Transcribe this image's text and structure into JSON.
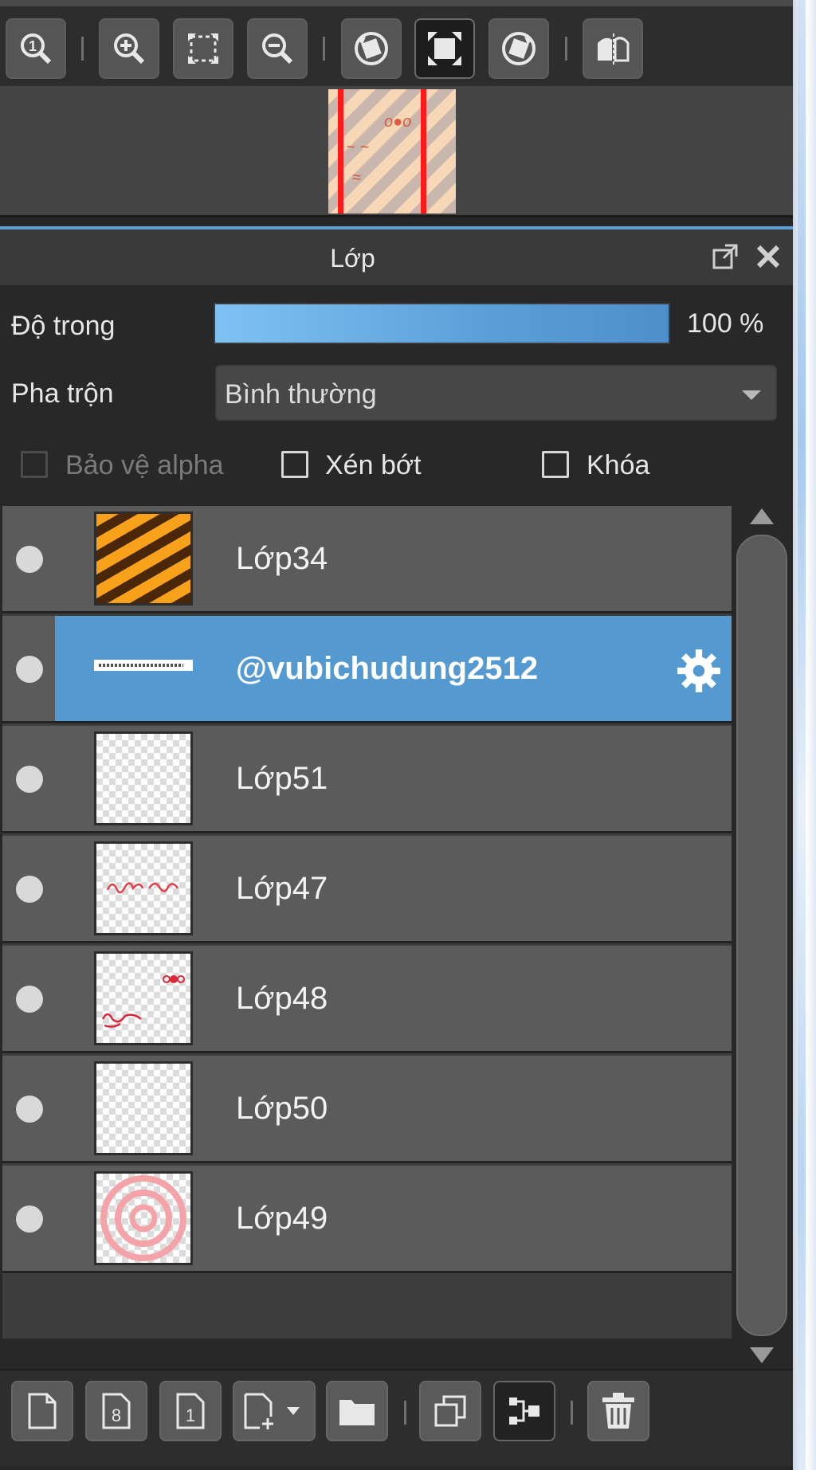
{
  "panel": {
    "title": "Lớp"
  },
  "opacity": {
    "label": "Độ trong",
    "value_text": "100 %",
    "value": 100
  },
  "blend": {
    "label": "Pha trộn",
    "selected": "Bình thường"
  },
  "options": {
    "protect_alpha": "Bảo vệ alpha",
    "clipping": "Xén bớt",
    "lock": "Khóa"
  },
  "layers": [
    {
      "name": "Lớp34",
      "thumbnail": "orange-stripes"
    },
    {
      "name": "@vubichudung2512",
      "thumbnail": "text-strip",
      "selected": true
    },
    {
      "name": "Lớp51",
      "thumbnail": "transparent"
    },
    {
      "name": "Lớp47",
      "thumbnail": "red-script"
    },
    {
      "name": "Lớp48",
      "thumbnail": "red-ornaments"
    },
    {
      "name": "Lớp50",
      "thumbnail": "transparent"
    },
    {
      "name": "Lớp49",
      "thumbnail": "pink-rings"
    }
  ],
  "colors": {
    "accent": "#5599d1",
    "panel_bg": "#282828",
    "row_bg": "#5b5b5b"
  },
  "icons": {
    "navigator_toolbar": [
      "zoom-actual-icon",
      "zoom-in-icon",
      "fit-screen-icon",
      "zoom-out-icon",
      "rotate-left-icon",
      "fit-window-icon",
      "rotate-right-icon",
      "flip-horizontal-icon"
    ],
    "bottom_toolbar": [
      "new-layer-icon",
      "new-8bit-layer-icon",
      "new-1bit-layer-icon",
      "add-layer-menu-icon",
      "new-folder-icon",
      "duplicate-layer-icon",
      "merge-down-icon",
      "delete-layer-icon"
    ]
  }
}
